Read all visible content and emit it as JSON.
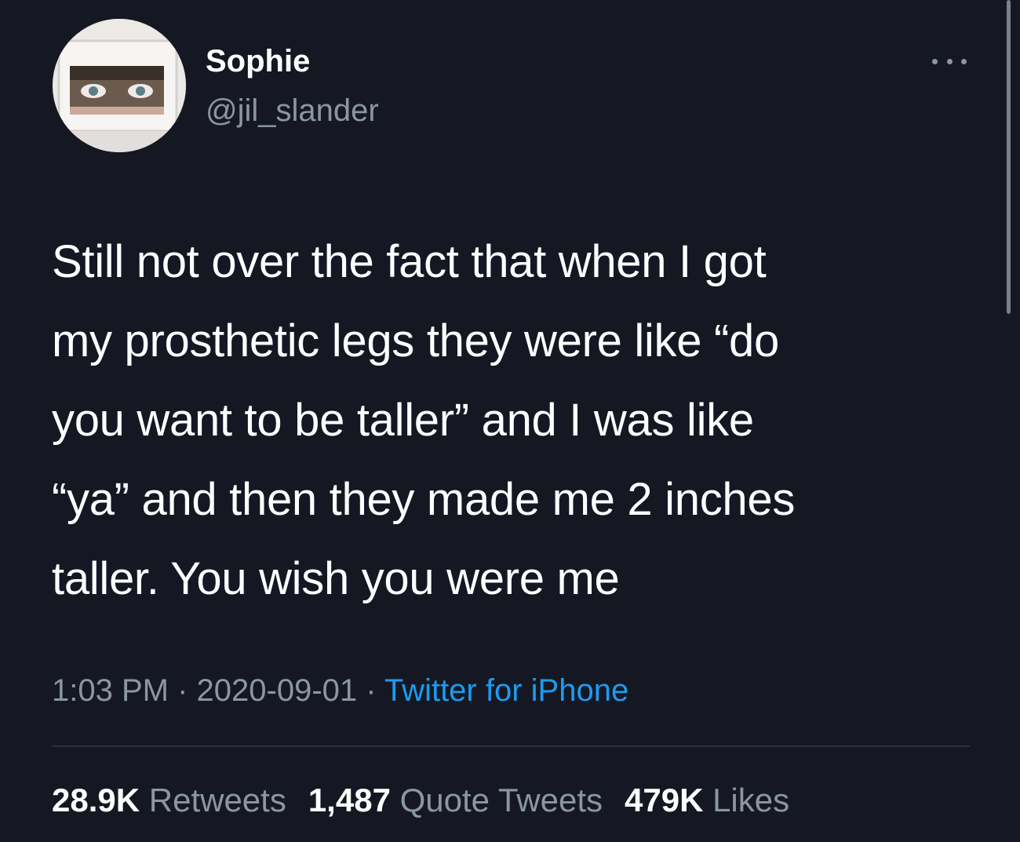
{
  "author": {
    "display_name": "Sophie",
    "handle": "@jil_slander",
    "avatar_icon": "avatar-photo"
  },
  "more_icon": "more-horizontal-icon",
  "tweet": {
    "lines": [
      "Still not over the fact that when I got",
      "my prosthetic legs they were like “do",
      "you want to be taller” and I was like",
      "“ya” and then they made me 2 inches",
      "taller. You wish you were me"
    ]
  },
  "meta": {
    "time": "1:03 PM",
    "separator": " · ",
    "date": "2020-09-01",
    "source": "Twitter for iPhone"
  },
  "stats": {
    "retweets_count": "28.9K",
    "retweets_label": "Retweets",
    "quotes_count": "1,487",
    "quotes_label": "Quote Tweets",
    "likes_count": "479K",
    "likes_label": "Likes"
  },
  "colors": {
    "background": "#151823",
    "text": "#ffffff",
    "secondary": "#8b96a3",
    "link": "#1d9bf0"
  }
}
